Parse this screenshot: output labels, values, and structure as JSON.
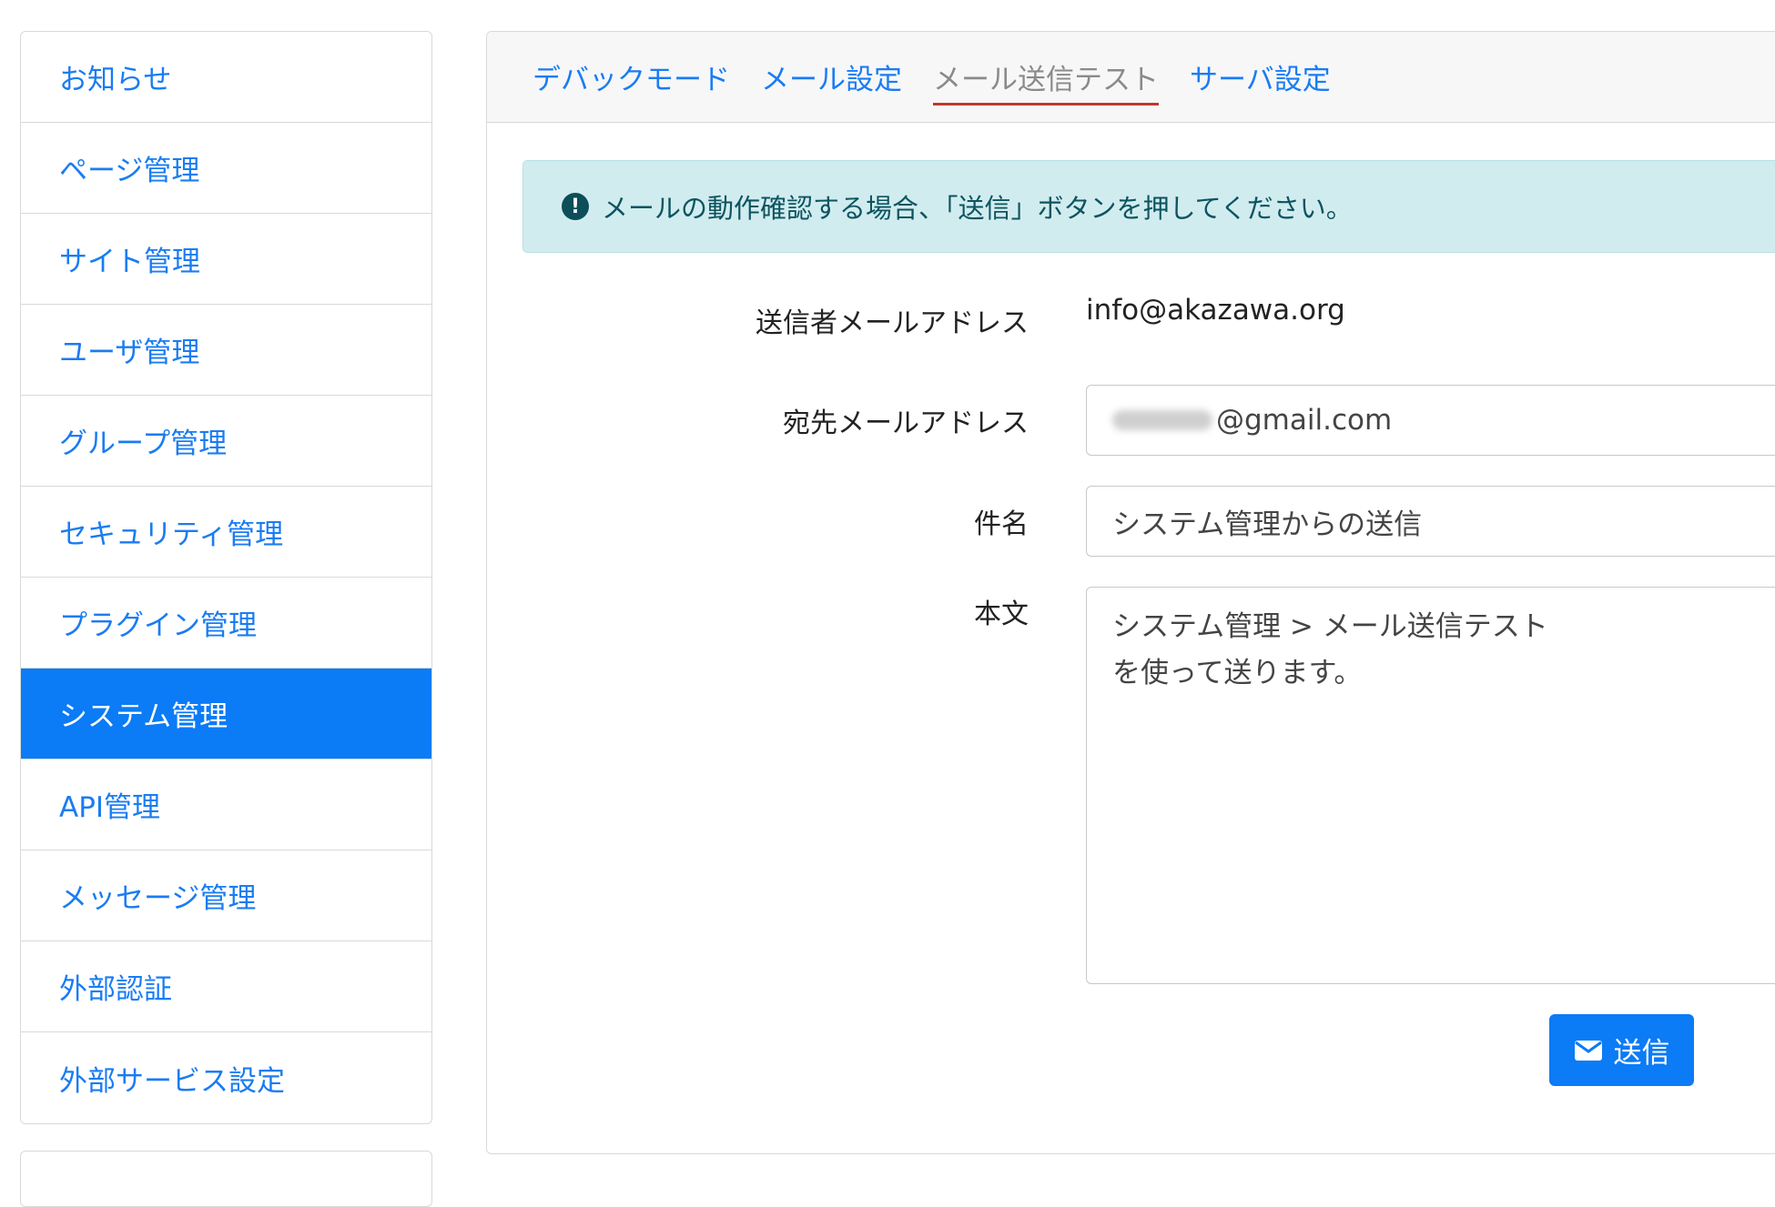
{
  "sidebar": {
    "items": [
      {
        "label": "お知らせ"
      },
      {
        "label": "ページ管理"
      },
      {
        "label": "サイト管理"
      },
      {
        "label": "ユーザ管理"
      },
      {
        "label": "グループ管理"
      },
      {
        "label": "セキュリティ管理"
      },
      {
        "label": "プラグイン管理"
      },
      {
        "label": "システム管理",
        "active": true
      },
      {
        "label": "API管理"
      },
      {
        "label": "メッセージ管理"
      },
      {
        "label": "外部認証"
      },
      {
        "label": "外部サービス設定"
      }
    ]
  },
  "tabs": [
    {
      "label": "デバックモード"
    },
    {
      "label": "メール設定"
    },
    {
      "label": "メール送信テスト",
      "active": true
    },
    {
      "label": "サーバ設定"
    }
  ],
  "alert": {
    "icon": "exclamation-circle-icon",
    "text": "メールの動作確認する場合、「送信」ボタンを押してください。"
  },
  "form": {
    "sender": {
      "label": "送信者メールアドレス",
      "value": "info@akazawa.org"
    },
    "recipient": {
      "label": "宛先メールアドレス",
      "value_suffix": "@gmail.com"
    },
    "subject": {
      "label": "件名",
      "value": "システム管理からの送信"
    },
    "body": {
      "label": "本文",
      "line1": "システム管理 > メール送信テスト",
      "line2": "を使って送ります。"
    }
  },
  "send_button": {
    "label": "送信",
    "icon": "envelope-icon"
  },
  "colors": {
    "primary": "#0b7bf6",
    "link": "#1a7cf2",
    "alert_bg": "#d1ecef",
    "active_underline": "#c0392b"
  }
}
